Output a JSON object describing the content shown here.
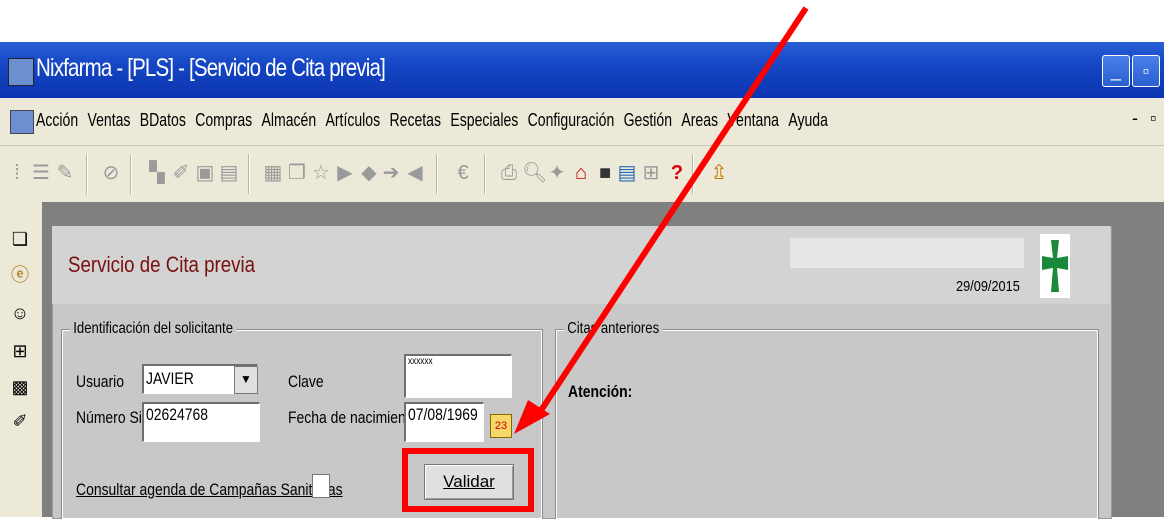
{
  "window": {
    "title": "Nixfarma - [PLS] - [Servicio de Cita previa]",
    "minimize": "_",
    "restore": "▫",
    "mdi_minimize": "-",
    "mdi_restore": "▫"
  },
  "menu": {
    "items": [
      "Acción",
      "Ventas",
      "BDatos",
      "Compras",
      "Almacén",
      "Artículos",
      "Recetas",
      "Especiales",
      "Configuración",
      "Gestión",
      "Areas",
      "Ventana",
      "Ayuda"
    ]
  },
  "toolbar": {
    "icons": [
      "grip-icon",
      "list-icon",
      "edit-icon",
      "cancel-icon",
      "binoculars-icon",
      "notes-icon",
      "window-icon",
      "doc-icon",
      "table-icon",
      "copy-icon",
      "star-icon",
      "export-icon",
      "arrow-left-icon",
      "arrow-right-icon",
      "import-icon",
      "euro-icon",
      "print-icon",
      "zoom-icon",
      "tool-icon",
      "lock-icon",
      "stop-icon",
      "calendar-icon",
      "cart-icon",
      "help-icon",
      "upload-icon"
    ]
  },
  "left_toolbar": {
    "icons": [
      "book-icon",
      "euro-coin-icon",
      "person-icon",
      "cart-icon",
      "bag-icon",
      "pen-icon"
    ]
  },
  "form": {
    "title": "Servicio de Cita previa",
    "date": "29/09/2015",
    "solicitante_legend": "Identificación del solicitante",
    "usuario_label": "Usuario",
    "usuario_value": "JAVIER",
    "clave_label": "Clave",
    "clave_value": "xxxxxx",
    "sip_label": "Número Sip",
    "sip_value": "02624768",
    "nacimiento_label": "Fecha de nacimiento",
    "nacimiento_value": "07/08/1969",
    "campanas_label": "Consultar agenda de Campañas Sanitarias",
    "validar_label": "Validar",
    "citas_legend": "Citas anteriores",
    "atencion_label": "Atención:"
  },
  "colors": {
    "title_red": "#7a1010",
    "annotation_red": "#ff0000",
    "logo_green": "#1a8a3a"
  }
}
